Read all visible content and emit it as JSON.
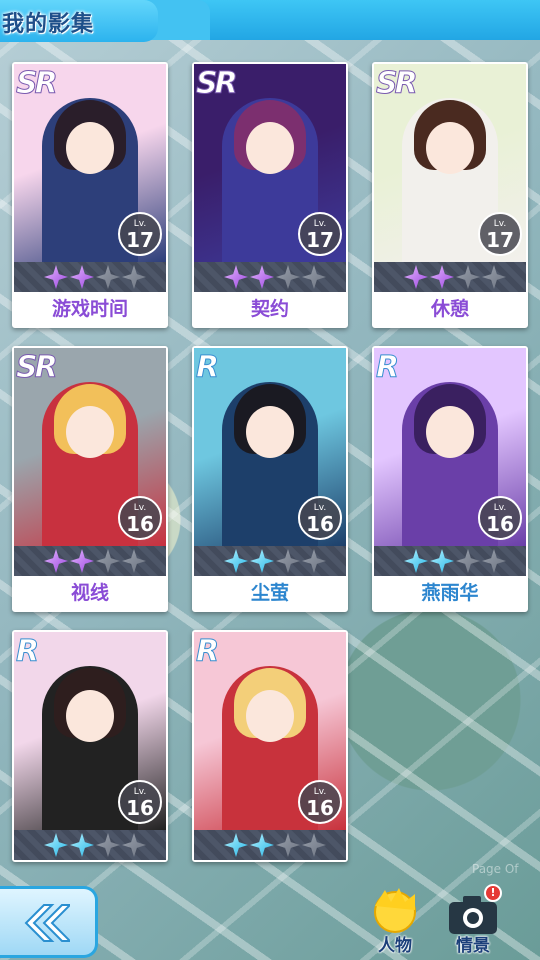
{
  "header": {
    "title": "我的影集"
  },
  "lv_prefix": "Lv.",
  "cards": [
    {
      "rarity": "SR",
      "level": "17",
      "name": "游戏时间",
      "stars": 2,
      "max_stars": 4,
      "palette": [
        "#f7d6ec",
        "#2d3f7a",
        "#2a1e2a"
      ]
    },
    {
      "rarity": "SR",
      "level": "17",
      "name": "契约",
      "stars": 2,
      "max_stars": 4,
      "palette": [
        "#3a1e6a",
        "#3d3a9a",
        "#7c2f6f"
      ]
    },
    {
      "rarity": "SR",
      "level": "17",
      "name": "休憩",
      "stars": 2,
      "max_stars": 4,
      "palette": [
        "#e9f1d6",
        "#f2f0ec",
        "#4a2a20"
      ]
    },
    {
      "rarity": "SR",
      "level": "16",
      "name": "视线",
      "stars": 2,
      "max_stars": 4,
      "palette": [
        "#9aa6ad",
        "#c8313f",
        "#f2c05a"
      ]
    },
    {
      "rarity": "R",
      "level": "16",
      "name": "尘萤",
      "stars": 2,
      "max_stars": 4,
      "palette": [
        "#6ec7e0",
        "#1d3f6a",
        "#1a1a22"
      ]
    },
    {
      "rarity": "R",
      "level": "16",
      "name": "燕雨华",
      "stars": 2,
      "max_stars": 4,
      "palette": [
        "#e3c6ff",
        "#6a3fa8",
        "#3a2060"
      ]
    },
    {
      "rarity": "R",
      "level": "16",
      "name": "",
      "stars": 2,
      "max_stars": 4,
      "palette": [
        "#f2d7ea",
        "#222222",
        "#2e1e1e"
      ]
    },
    {
      "rarity": "R",
      "level": "16",
      "name": "",
      "stars": 2,
      "max_stars": 4,
      "palette": [
        "#f6c7d6",
        "#c8323c",
        "#f3cf79"
      ]
    }
  ],
  "nav": {
    "characters_label": "人物",
    "scenes_label": "情景",
    "scenes_badge": "!"
  },
  "watermark": "Page Of",
  "colors": {
    "header": "#27b8f0",
    "sr_star": "#9a45e0",
    "r_star": "#23b6e8"
  }
}
